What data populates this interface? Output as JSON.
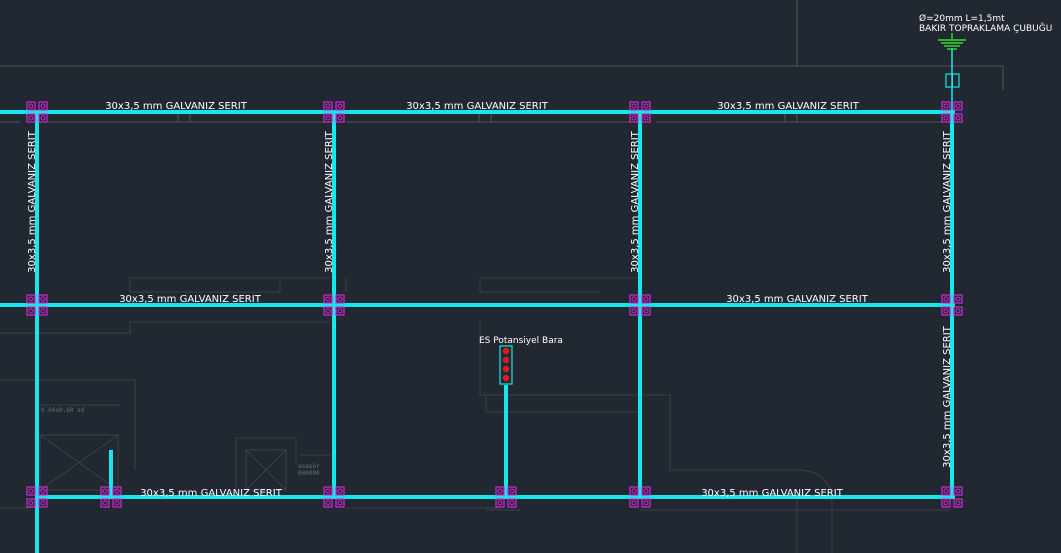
{
  "tape_labels": {
    "top_1": "30x3,5 mm GALVANIZ SERIT",
    "top_2": "30x3,5 mm GALVANIZ SERIT",
    "top_3": "30x3,5 mm GALVANIZ SERIT",
    "mid_1": "30x3,5 mm GALVANIZ SERIT",
    "mid_2": "30x3,5 mm GALVANIZ SERIT",
    "bot_1": "30x3,5 mm GALVANIZ SERIT",
    "bot_2": "30x3,5 mm GALVANIZ SERIT",
    "vert_1": "30x3,5 mm GALVANIZ SERIT",
    "vert_2": "30x3,5 mm GALVANIZ SERIT",
    "vert_3": "30x3,5 mm GALVANIZ SERIT",
    "vert_4": "30x3,5 mm GALVANIZ SERIT",
    "vert_5": "30x3,5 mm GALVANIZ SERIT"
  },
  "ground_rod": {
    "line1": "Ø=20mm L=1,5mt",
    "line2": "BAKIR TOPRAKLAMA ÇUBUĞU"
  },
  "potential_bar": {
    "label": "ES Potansiyel Bara"
  },
  "faint_labels": {
    "a": "0.60x0.60 sd",
    "b": "asasör",
    "c": "000000"
  },
  "colors": {
    "background": "#222831",
    "tape": "#19e6ec",
    "clamp": "#d626d6",
    "ground": "#2fe02f",
    "bar_dots": "#e11b1b",
    "text": "#ffffff"
  }
}
